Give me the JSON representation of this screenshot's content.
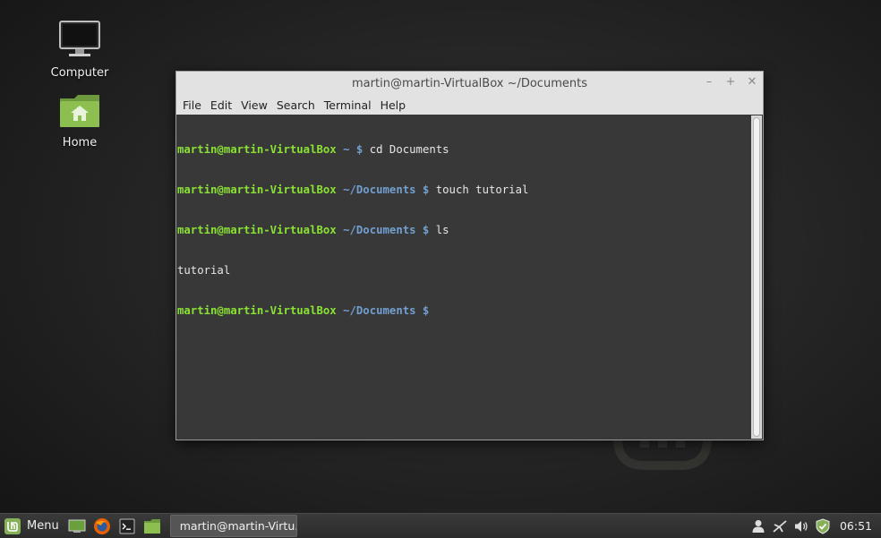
{
  "desktop": {
    "icons": [
      {
        "label": "Computer",
        "icon": "computer-icon"
      },
      {
        "label": "Home",
        "icon": "home-folder-icon"
      }
    ]
  },
  "window": {
    "title": "martin@martin-VirtualBox ~/Documents",
    "controls": {
      "minimize": "–",
      "maximize": "+",
      "close": "✕"
    },
    "menu": [
      "File",
      "Edit",
      "View",
      "Search",
      "Terminal",
      "Help"
    ]
  },
  "terminal": {
    "lines": [
      {
        "user": "martin@martin-VirtualBox",
        "path": " ~",
        "prompt": " $ ",
        "cmd": "cd Documents"
      },
      {
        "user": "martin@martin-VirtualBox",
        "path": " ~/Documents",
        "prompt": " $ ",
        "cmd": "touch tutorial"
      },
      {
        "user": "martin@martin-VirtualBox",
        "path": " ~/Documents",
        "prompt": " $ ",
        "cmd": "ls"
      },
      {
        "output": "tutorial"
      },
      {
        "user": "martin@martin-VirtualBox",
        "path": " ~/Documents",
        "prompt": " $ ",
        "cmd": ""
      }
    ]
  },
  "taskbar": {
    "menu_label": "Menu",
    "launchers": [
      "show-desktop-icon",
      "firefox-icon",
      "terminal-icon",
      "files-icon"
    ],
    "task_label": "martin@martin-Virtu...",
    "tray_icons": [
      "user-icon",
      "network-icon",
      "volume-icon",
      "update-shield-icon"
    ],
    "clock": "06:51"
  },
  "colors": {
    "user": "#8ae234",
    "path": "#729fcf",
    "mint_green": "#87b158"
  }
}
